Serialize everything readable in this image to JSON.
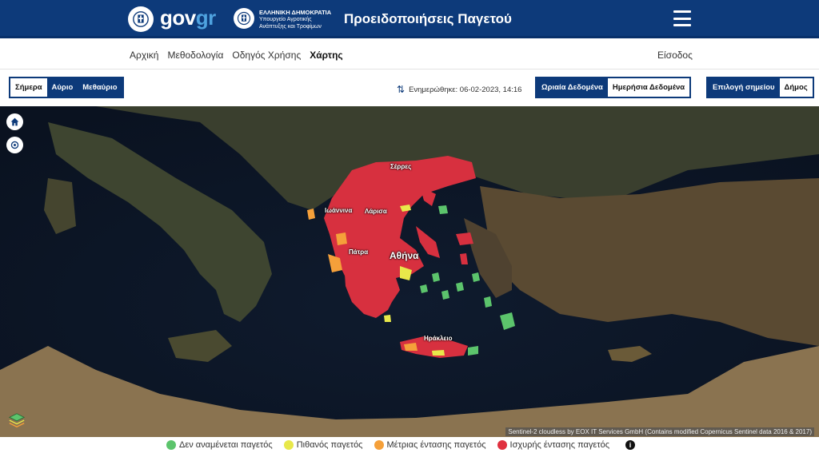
{
  "header": {
    "brand_gov": "gov",
    "brand_gr": "gr",
    "ministry_line1": "ΕΛΛΗΝΙΚΗ ΔΗΜΟΚΡΑΤΙΑ",
    "ministry_line2": "Υπουργείο Αγροτικής Ανάπτυξης και Τροφίμων",
    "title": "Προειδοποιήσεις Παγετού",
    "menu_icon": "hamburger-icon"
  },
  "nav": {
    "items": [
      {
        "label": "Αρχική"
      },
      {
        "label": "Μεθοδολογία"
      },
      {
        "label": "Οδηγός Χρήσης"
      },
      {
        "label": "Χάρτης"
      }
    ],
    "active": "Χάρτης",
    "login": "Είσοδος"
  },
  "controls": {
    "days": {
      "today": "Σήμερα",
      "tomorrow": "Αύριο",
      "day_after": "Μεθαύριο",
      "selected": "Σήμερα"
    },
    "updated": "Ενημερώθηκε: 06-02-2023, 14:16",
    "data_type": {
      "hourly": "Ωριαία Δεδομένα",
      "daily": "Ημερήσια Δεδομένα",
      "selected": "Ημερήσια Δεδομένα"
    },
    "selection": {
      "point": "Επιλογή σημείου",
      "municipality": "Δήμος",
      "selected": "Δήμος"
    }
  },
  "map": {
    "labels": {
      "serres": "Σέρρες",
      "ioannina": "Ιωάννινα",
      "larisa": "Λάρισα",
      "patra": "Πάτρα",
      "athina": "Αθήνα",
      "irakleio": "Ηράκλειο"
    },
    "attribution": "Sentinel-2 cloudless by EOX IT Services GmbH (Contains modified Copernicus Sentinel data 2016 & 2017)",
    "home_icon": "home-icon",
    "locate_icon": "locate-icon",
    "layers_icon": "layers-icon"
  },
  "legend": {
    "items": [
      {
        "label": "Δεν αναμένεται παγετός",
        "color": "#5cc46c"
      },
      {
        "label": "Πιθανός παγετός",
        "color": "#e8e84a"
      },
      {
        "label": "Μέτριας έντασης παγετός",
        "color": "#f5a03a"
      },
      {
        "label": "Ισχυρής έντασης παγετός",
        "color": "#e0303f"
      }
    ],
    "info_icon": "info-icon"
  }
}
